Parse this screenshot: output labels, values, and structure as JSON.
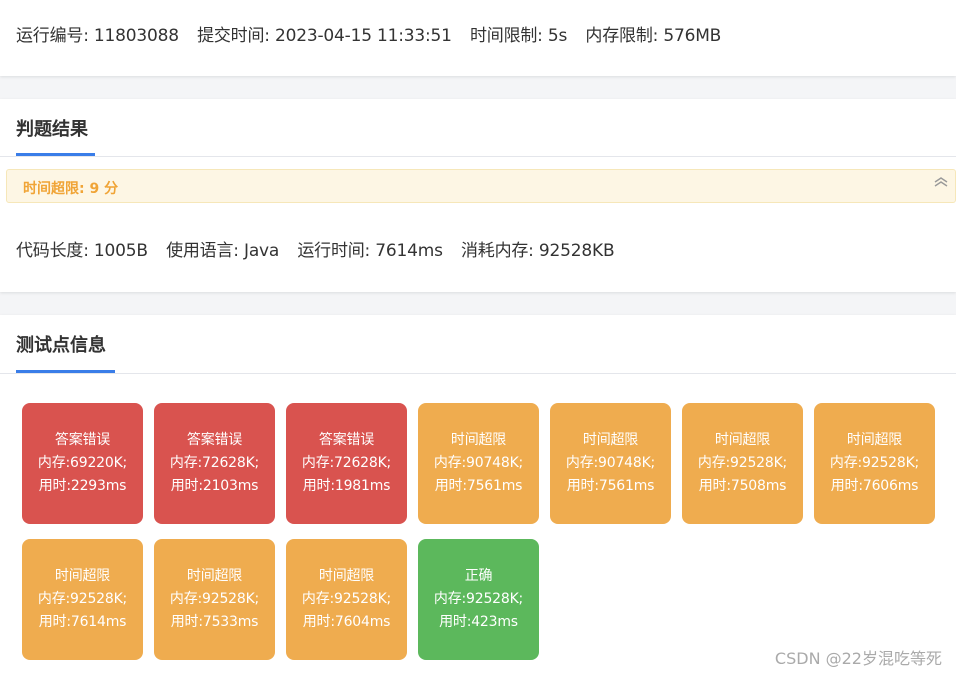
{
  "summary": {
    "run_id": "运行编号: 11803088",
    "submit_time": "提交时间: 2023-04-15 11:33:51",
    "time_limit": "时间限制: 5s",
    "memory_limit": "内存限制: 576MB"
  },
  "judge": {
    "title": "判题结果",
    "verdict": "时间超限:   9 分",
    "toggle_icon": "chevron-up-double",
    "code_length": "代码长度: 1005B",
    "language": "使用语言: Java",
    "run_time": "运行时间: 7614ms",
    "memory": "消耗内存: 92528KB"
  },
  "tests": {
    "title": "测试点信息",
    "cases": [
      {
        "status": "答案错误",
        "memory": "内存:69220K;",
        "time": "用时:2293ms",
        "kind": "wa"
      },
      {
        "status": "答案错误",
        "memory": "内存:72628K;",
        "time": "用时:2103ms",
        "kind": "wa"
      },
      {
        "status": "答案错误",
        "memory": "内存:72628K;",
        "time": "用时:1981ms",
        "kind": "wa"
      },
      {
        "status": "时间超限",
        "memory": "内存:90748K;",
        "time": "用时:7561ms",
        "kind": "tle"
      },
      {
        "status": "时间超限",
        "memory": "内存:90748K;",
        "time": "用时:7561ms",
        "kind": "tle"
      },
      {
        "status": "时间超限",
        "memory": "内存:92528K;",
        "time": "用时:7508ms",
        "kind": "tle"
      },
      {
        "status": "时间超限",
        "memory": "内存:92528K;",
        "time": "用时:7606ms",
        "kind": "tle"
      },
      {
        "status": "时间超限",
        "memory": "内存:92528K;",
        "time": "用时:7614ms",
        "kind": "tle"
      },
      {
        "status": "时间超限",
        "memory": "内存:92528K;",
        "time": "用时:7533ms",
        "kind": "tle"
      },
      {
        "status": "时间超限",
        "memory": "内存:92528K;",
        "time": "用时:7604ms",
        "kind": "tle"
      },
      {
        "status": "正确",
        "memory": "内存:92528K;",
        "time": "用时:423ms",
        "kind": "ac"
      }
    ]
  },
  "colors": {
    "wrong_answer": "#d9534f",
    "time_limit_exceeded": "#efac4f",
    "accepted": "#5cb85c",
    "accent": "#3a7de8"
  },
  "watermark": "CSDN @22岁混吃等死"
}
